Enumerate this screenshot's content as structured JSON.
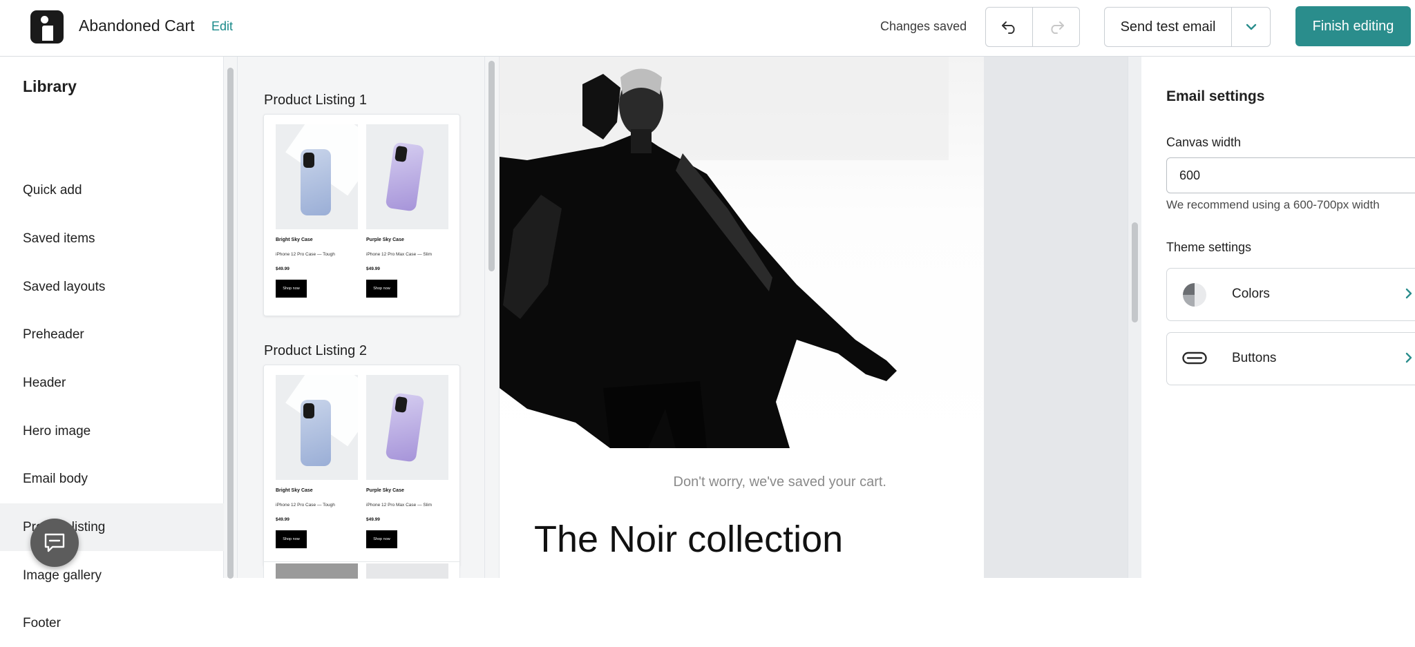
{
  "header": {
    "title": "Abandoned Cart",
    "edit_label": "Edit",
    "status": "Changes saved",
    "send_test_label": "Send test email",
    "finish_label": "Finish editing"
  },
  "library": {
    "title": "Library",
    "items": [
      {
        "label": "Quick add"
      },
      {
        "label": "Saved items"
      },
      {
        "label": "Saved layouts"
      },
      {
        "label": "Preheader"
      },
      {
        "label": "Header"
      },
      {
        "label": "Hero image"
      },
      {
        "label": "Email body"
      },
      {
        "label": "Product listing",
        "active": true
      },
      {
        "label": "Image gallery"
      },
      {
        "label": "Footer"
      }
    ]
  },
  "templates": [
    {
      "label": "Product Listing 1",
      "products": [
        {
          "name": "Bright Sky Case",
          "desc": "iPhone 12 Pro Case — Tough",
          "price": "$49.99",
          "button": "Shop now"
        },
        {
          "name": "Purple Sky Case",
          "desc": "iPhone 12 Pro Max Case — Slim",
          "price": "$49.99",
          "button": "Shop now"
        }
      ]
    },
    {
      "label": "Product Listing 2",
      "products": [
        {
          "name": "Bright Sky Case",
          "desc": "iPhone 12 Pro Case — Tough",
          "price": "$49.99",
          "button": "Shop now"
        },
        {
          "name": "Purple Sky Case",
          "desc": "iPhone 12 Pro Max Case — Slim",
          "price": "$49.99",
          "button": "Shop now"
        }
      ]
    }
  ],
  "email": {
    "tagline": "Don't worry, we've saved your cart.",
    "headline": "The Noir collection"
  },
  "settings": {
    "title": "Email settings",
    "canvas_width_label": "Canvas width",
    "canvas_width_value": "600",
    "canvas_width_hint": "We recommend using a 600-700px width",
    "theme_label": "Theme settings",
    "theme_items": [
      {
        "label": "Colors",
        "icon": "color-palette-icon"
      },
      {
        "label": "Buttons",
        "icon": "button-shape-icon"
      }
    ]
  },
  "colors": {
    "accent": "#2a8d8c",
    "link": "#1a8a8a"
  }
}
